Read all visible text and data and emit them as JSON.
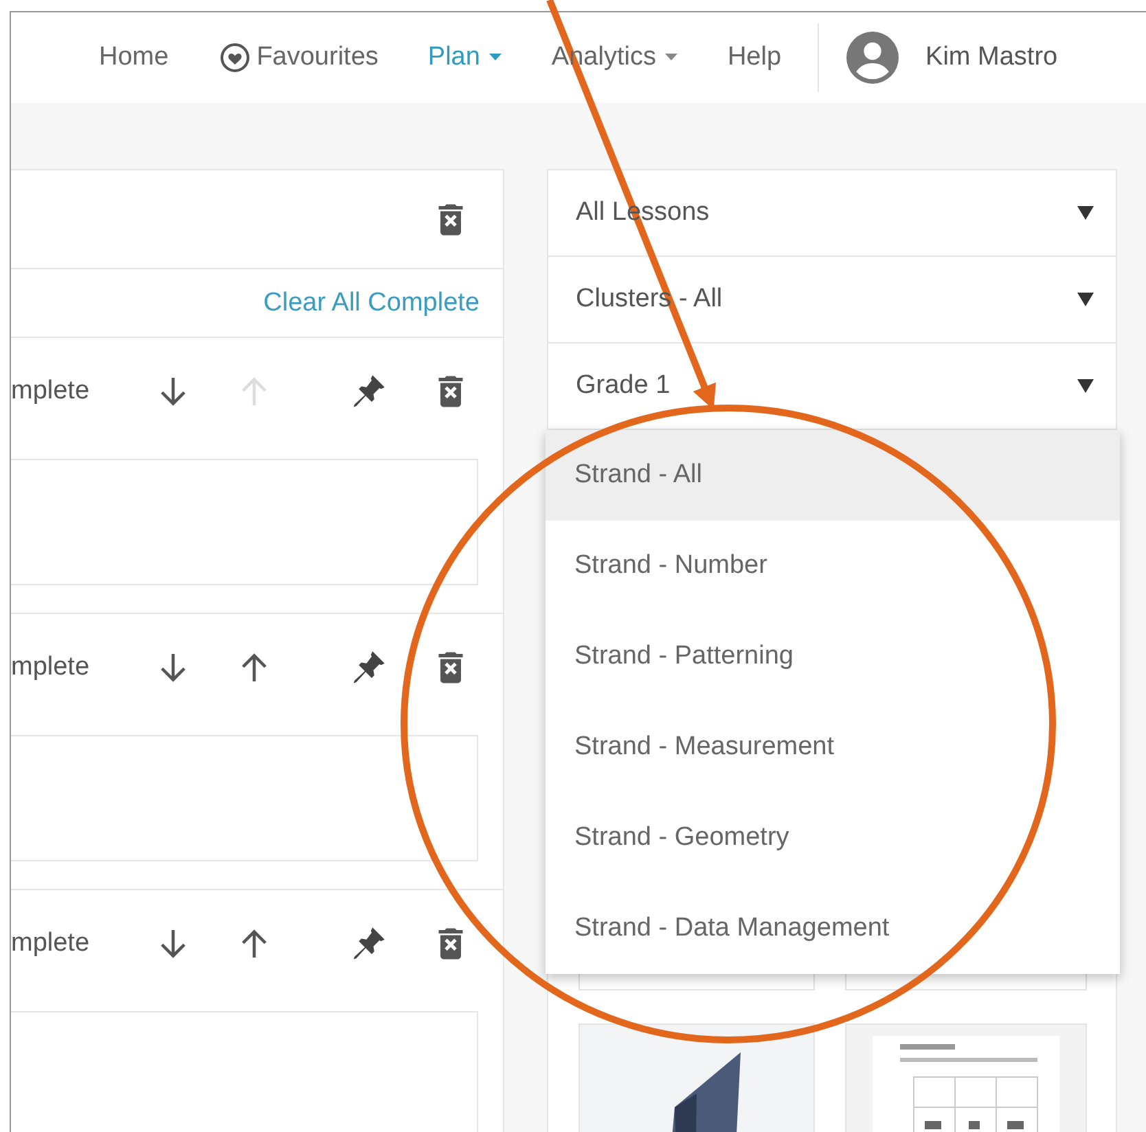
{
  "nav": {
    "items": [
      {
        "label": "Home",
        "kind": "plain",
        "dropdown": false,
        "selected": false
      },
      {
        "label": "Favourites",
        "kind": "favourite",
        "dropdown": false,
        "selected": false
      },
      {
        "label": "Plan",
        "kind": "plain",
        "dropdown": true,
        "selected": true
      },
      {
        "label": "Analytics",
        "kind": "plain",
        "dropdown": true,
        "selected": false
      },
      {
        "label": "Help",
        "kind": "plain",
        "dropdown": false,
        "selected": false
      }
    ],
    "user": {
      "name": "Kim Mastro"
    }
  },
  "plan_panel": {
    "clear_link": "Clear All Complete",
    "items": [
      {
        "status": "mplete",
        "up_disabled": true
      },
      {
        "status": "mplete",
        "up_disabled": false
      },
      {
        "status": "mplete",
        "up_disabled": false
      }
    ]
  },
  "filters": [
    {
      "label": "All Lessons"
    },
    {
      "label": "Clusters - All"
    },
    {
      "label": "Grade 1"
    }
  ],
  "strand_menu": {
    "options": [
      {
        "label": "Strand - All",
        "selected": true
      },
      {
        "label": "Strand - Number",
        "selected": false
      },
      {
        "label": "Strand - Patterning",
        "selected": false
      },
      {
        "label": "Strand - Measurement",
        "selected": false
      },
      {
        "label": "Strand - Geometry",
        "selected": false
      },
      {
        "label": "Strand - Data Management",
        "selected": false
      }
    ]
  },
  "lesson_cards": [
    {
      "kind": "blank"
    },
    {
      "kind": "blank"
    },
    {
      "kind": "picture"
    },
    {
      "kind": "picture"
    }
  ]
}
